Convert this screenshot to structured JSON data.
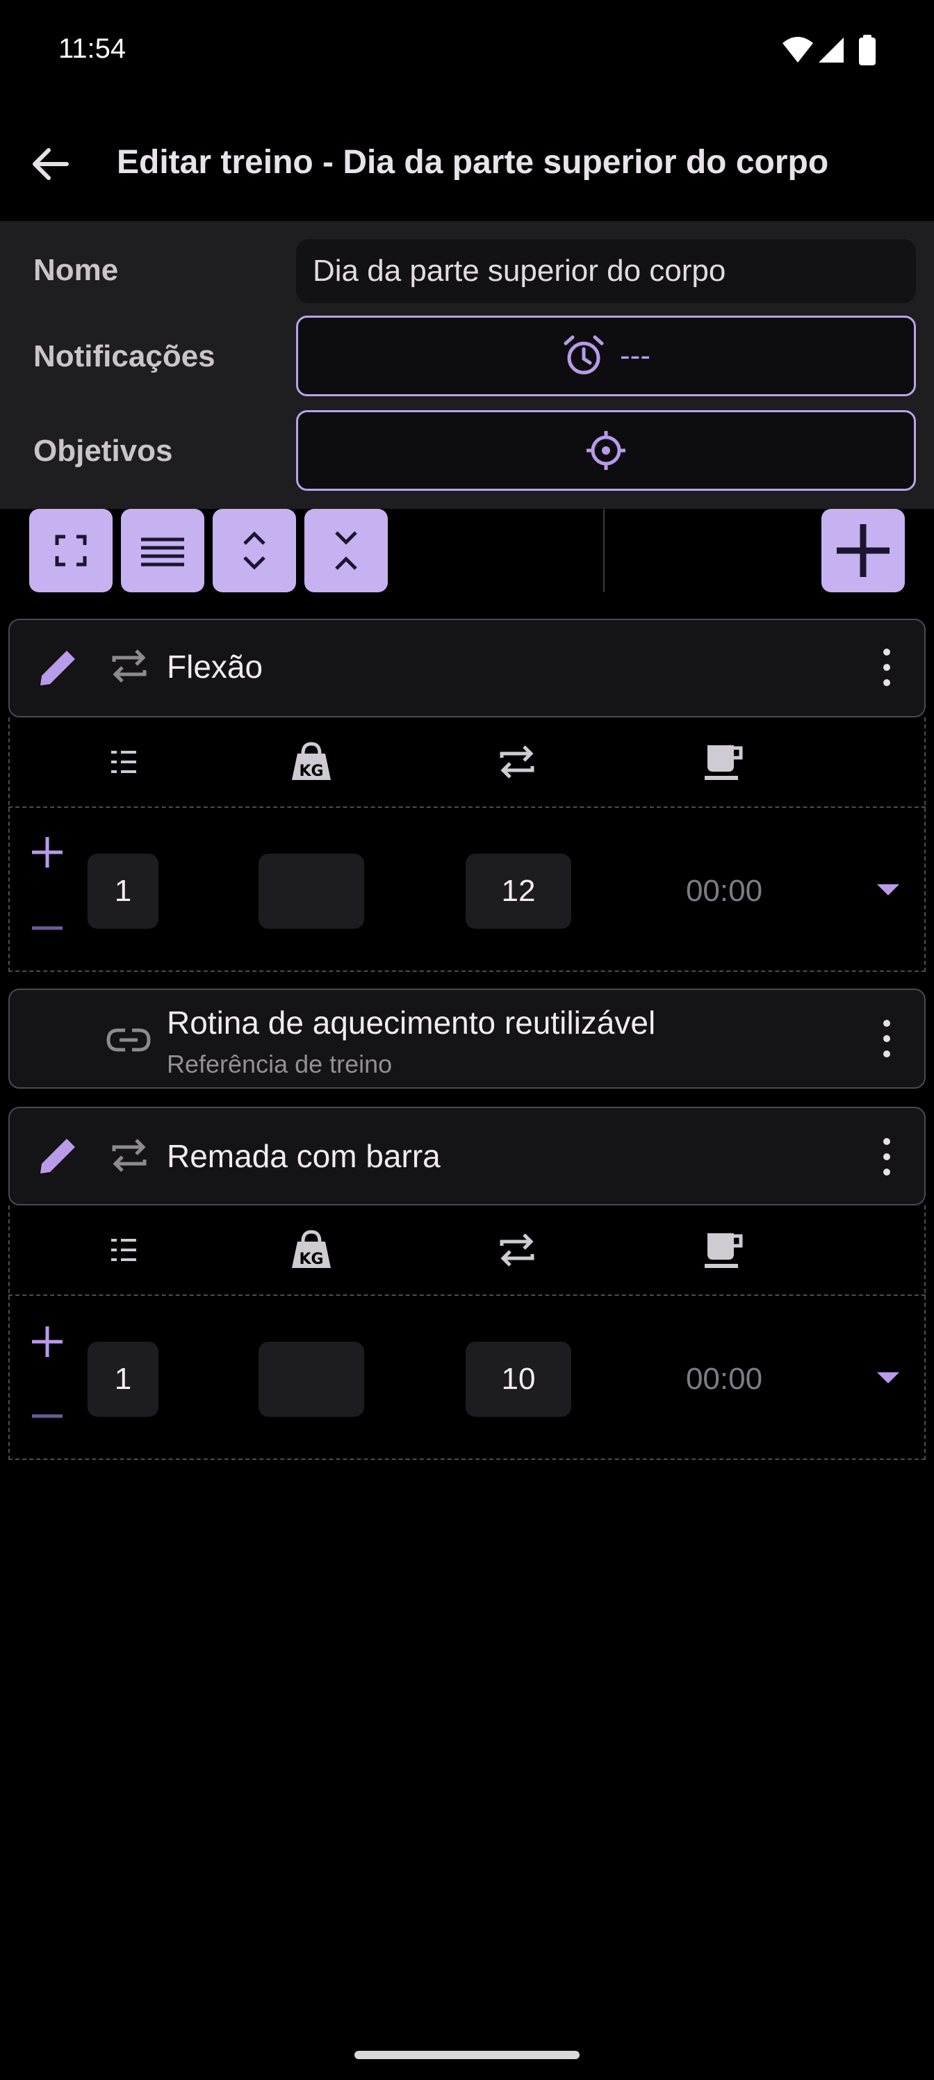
{
  "status_bar": {
    "time": "11:54"
  },
  "app_bar": {
    "title": "Editar treino - Dia da parte superior do corpo"
  },
  "form": {
    "name_label": "Nome",
    "name_value": "Dia da parte superior do corpo",
    "notifications_label": "Notificações",
    "notifications_value": "---",
    "goals_label": "Objetivos"
  },
  "toolbar": {
    "buttons": [
      "fullscreen-icon",
      "menu-lines-icon",
      "expand-icon",
      "collapse-icon"
    ],
    "add": "plus-icon"
  },
  "exercises": [
    {
      "name": "Flexão",
      "columns": [
        "list-icon",
        "kettlebell-kg-icon",
        "repeat-icon",
        "coffee-cup-icon"
      ],
      "sets": "1",
      "weight": "",
      "reps": "12",
      "rest": "00:00"
    },
    {
      "name": "Remada com barra",
      "columns": [
        "list-icon",
        "kettlebell-kg-icon",
        "repeat-icon",
        "coffee-cup-icon"
      ],
      "sets": "1",
      "weight": "",
      "reps": "10",
      "rest": "00:00"
    }
  ],
  "reference": {
    "title": "Rotina de aquecimento reutilizável",
    "subtitle": "Referência de treino"
  },
  "colors": {
    "accent": "#c6b2f0",
    "accent_icon": "#b89be9",
    "background": "#000000",
    "panel": "#1e1d20"
  }
}
